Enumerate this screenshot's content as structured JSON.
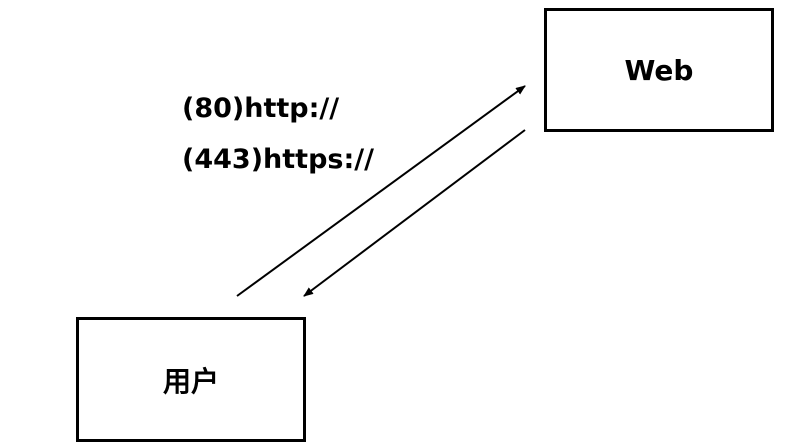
{
  "nodes": {
    "web": {
      "label": "Web"
    },
    "user": {
      "label": "用户"
    }
  },
  "labels": {
    "http": "(80)http://",
    "https": "(443)https://"
  },
  "colors": {
    "stroke": "#000000",
    "background": "#ffffff"
  }
}
